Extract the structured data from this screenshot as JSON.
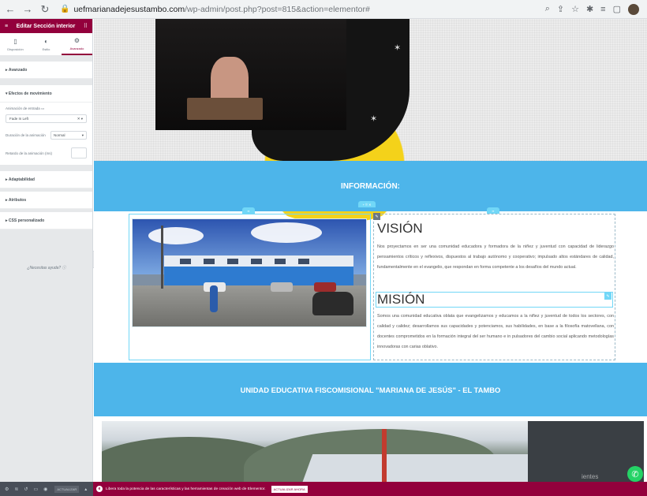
{
  "browser": {
    "url_host": "uefmarianadejesustambo.com",
    "url_path": "/wp-admin/post.php?post=815&action=elementor#"
  },
  "panel": {
    "title": "Editar Sección interior",
    "tabs": [
      {
        "label": "Disposición",
        "icon": "layout-icon"
      },
      {
        "label": "Estilo",
        "icon": "contrast-icon"
      },
      {
        "label": "Avanzado",
        "icon": "gear-icon"
      }
    ],
    "sections": {
      "avanzado": "Avanzado",
      "efectos": "Efectos de movimiento",
      "adaptabilidad": "Adaptabilidad",
      "atributos": "Atributos",
      "css": "CSS personalizado"
    },
    "entrance_label": "Animación de entrada",
    "entrance_value": "Fade In Left",
    "duration_label": "Duración de la animación",
    "duration_value": "Normal",
    "delay_label": "Retardo de la animación (ms)",
    "help": "¿Necesitas ayuda?",
    "footer_update": "ACTUALIZAR"
  },
  "canvas": {
    "info_heading": "INFORMACIÓN:",
    "vision_heading": "VISIÓN",
    "vision_text": "Nos proyectamos en ser una comunidad educadora y formadora de la niñez y juventud con capacidad de liderazgo pensamientos críticos y reflexivos, dispuestos al trabajo autónomo y cooperativo; impulsado altos estándares de calidad, fundamentalmente en el evangelio, que respondan en forma competente a los desafíos del mundo actual.",
    "mission_heading": "MISIÓN",
    "mission_text": "Somos una comunidad educativa oblata que evangelizamos y educamos a la niñez y juventud de todos los sectores, con calidad y calidez; desarrollamos sus capacidades y potenciamos, sus habilidades, en base a la filosofía matovellana, con docentes comprometidos en la formación integral del ser humano e in pulsadores del cambio social aplicando metodologías innovadoras con carias oblativo.",
    "school_heading": "UNIDAD EDUCATIVA FISCOMISIONAL \"MARIANA DE JESÚS\" - EL TAMBO",
    "faint_text": "ientes"
  },
  "notice": {
    "message": "Libera toda la potencia de las características y las herramientas de creación web de Elementor.",
    "button": "ACTUALIZAR AHORA"
  },
  "colors": {
    "brand": "#93003c",
    "band_blue": "#4db5ea",
    "selection": "#71d7f7"
  }
}
